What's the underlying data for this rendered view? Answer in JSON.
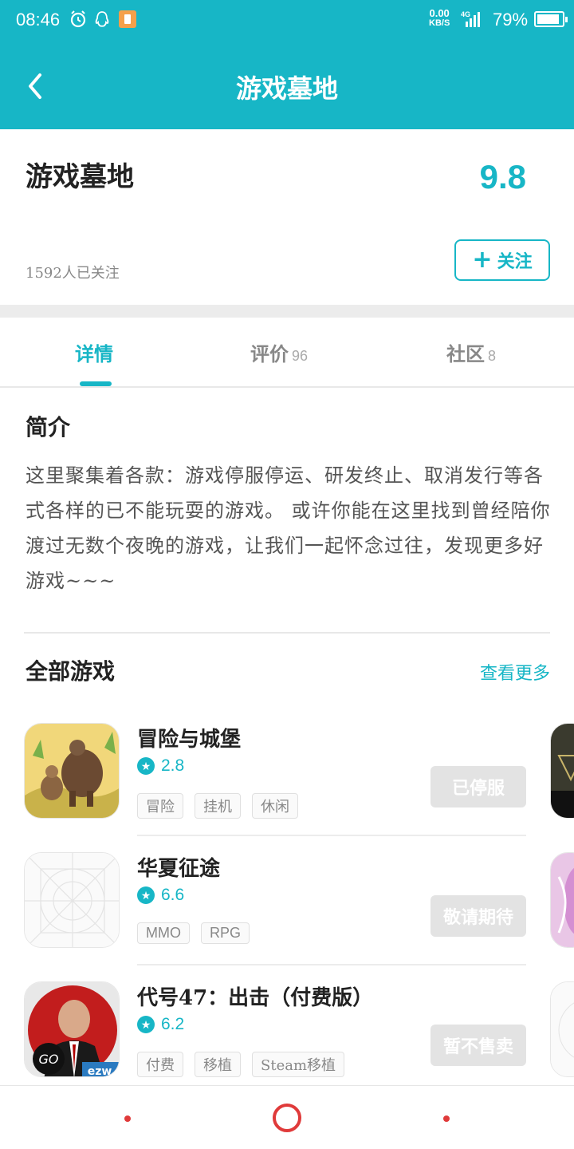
{
  "status_bar": {
    "time": "08:46",
    "net_speed": "0.00",
    "net_unit": "KB/S",
    "net_type": "4G",
    "battery": "79%"
  },
  "nav": {
    "title": "游戏墓地"
  },
  "header": {
    "name": "游戏墓地",
    "score": "9.8",
    "followers": "1592人已关注",
    "follow_label": "关注"
  },
  "tabs": [
    {
      "label": "详情",
      "count": ""
    },
    {
      "label": "评价",
      "count": "96"
    },
    {
      "label": "社区",
      "count": "8"
    }
  ],
  "intro": {
    "title": "简介",
    "text": "这里聚集着各款：游戏停服停运、研发终止、取消发行等各式各样的已不能玩耍的游戏。 或许你能在这里找到曾经陪你渡过无数个夜晚的游戏，让我们一起怀念过往，发现更多好游戏~~~"
  },
  "games_section": {
    "title": "全部游戏",
    "more": "查看更多"
  },
  "games": [
    {
      "name": "冒险与城堡",
      "rating": "2.8",
      "tags": [
        "冒险",
        "挂机",
        "休闲"
      ],
      "status": "已停服"
    },
    {
      "name": "华夏征途",
      "rating": "6.6",
      "tags": [
        "MMO",
        "RPG"
      ],
      "status": "敬请期待"
    },
    {
      "name": "代号47：出击（付费版）",
      "rating": "6.2",
      "tags": [
        "付费",
        "移植",
        "Steam移植"
      ],
      "status": "暂不售卖"
    }
  ],
  "icon_badges": {
    "go": "GO",
    "ezw": "ezw"
  },
  "colors": {
    "accent": "#17b6c6",
    "nav_red": "#e03a3a"
  }
}
